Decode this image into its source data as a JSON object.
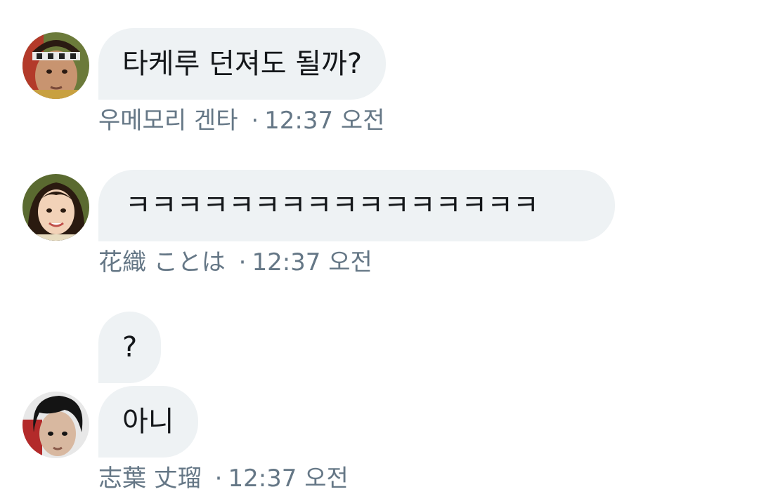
{
  "messages": [
    {
      "text": "타케루 던져도 될까?",
      "sender": "우메모리 겐타",
      "time": "12:37 오전",
      "avatar": "avatar-boy-headband"
    },
    {
      "text": "ㅋㅋㅋㅋㅋㅋㅋㅋㅋㅋㅋㅋㅋㅋㅋㅋ",
      "sender": "花織 ことは",
      "time": "12:37 오전",
      "avatar": "avatar-girl-smiling"
    },
    {
      "bubbles": [
        "?",
        "아니"
      ],
      "sender": "志葉 丈瑠",
      "time": "12:37 오전",
      "avatar": "avatar-boy-dark-hair"
    }
  ],
  "separator": "·",
  "colors": {
    "bubble_bg": "#eef2f4",
    "text": "#14171a",
    "meta": "#657786"
  }
}
